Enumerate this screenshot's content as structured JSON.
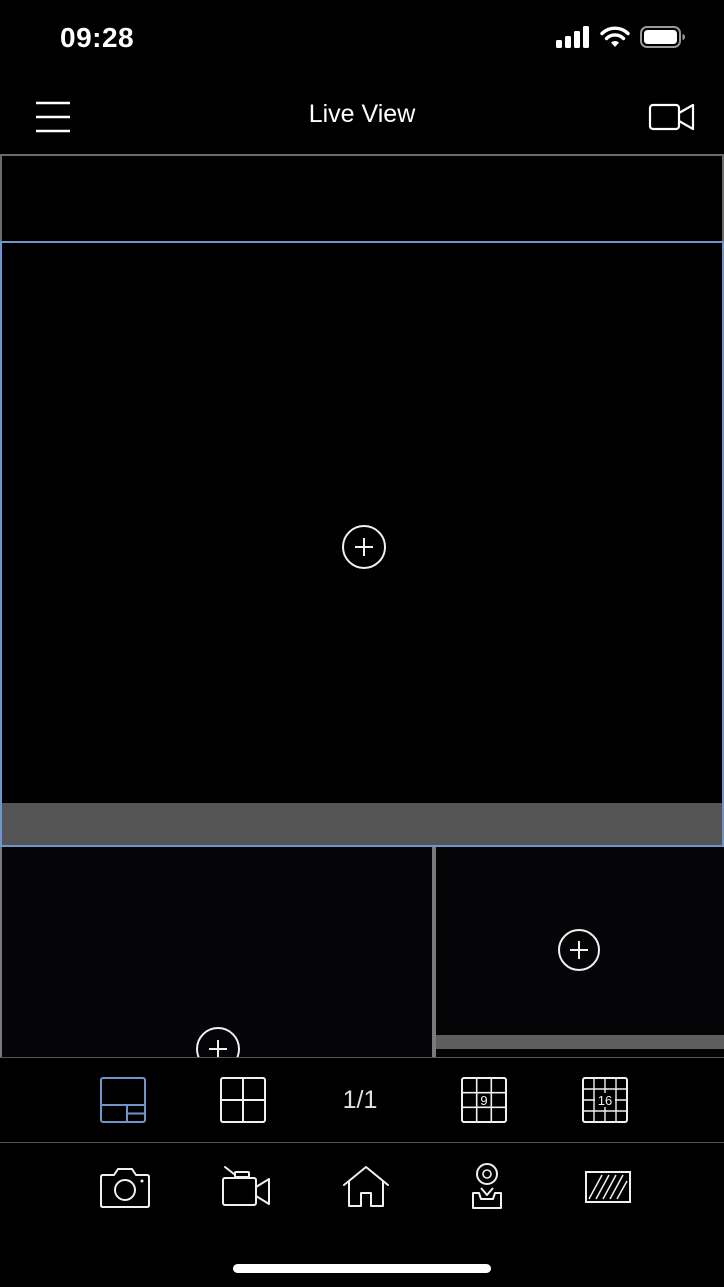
{
  "status_bar": {
    "time": "09:28",
    "icons": [
      "cellular-signal-icon",
      "wifi-icon",
      "battery-icon"
    ]
  },
  "nav": {
    "title": "Live View",
    "left_icon": "hamburger-menu-icon",
    "right_icon": "video-camera-icon"
  },
  "panes": [
    {
      "name": "main-pane",
      "selected": true,
      "action_icon": "add-camera-plus-icon"
    },
    {
      "name": "bottom-left-pane",
      "selected": false,
      "action_icon": "add-camera-plus-icon"
    },
    {
      "name": "bottom-right-pane",
      "selected": false,
      "action_icon": "add-camera-plus-icon"
    }
  ],
  "layout_bar": {
    "page_indicator": "1/1",
    "options": [
      {
        "icon": "layout-1-plus-2-icon",
        "active": true
      },
      {
        "icon": "layout-4-grid-icon",
        "active": false
      },
      {
        "icon": "layout-9-grid-icon",
        "label": "9",
        "active": false
      },
      {
        "icon": "layout-16-grid-icon",
        "label": "16",
        "active": false
      }
    ]
  },
  "tool_bar": {
    "items": [
      "snapshot-camera-icon",
      "record-video-icon",
      "home-icon",
      "ptz-control-icon",
      "fullscreen-frame-icon"
    ]
  },
  "colors": {
    "background": "#000000",
    "selected_border": "#6f94c9",
    "pane_border": "#7a7a7a",
    "pane_footer": "#545454",
    "icon": "#f0f0f0"
  }
}
